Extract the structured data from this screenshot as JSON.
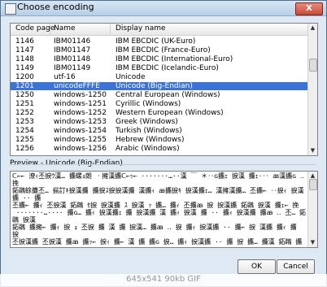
{
  "window": {
    "title": "Choose encoding"
  },
  "list": {
    "columns": [
      "Code page",
      "Name",
      "Display name"
    ],
    "rows": [
      [
        "1146",
        "IBM01146",
        "IBM EBCDIC (UK-Euro)"
      ],
      [
        "1147",
        "IBM01147",
        "IBM EBCDIC (France-Euro)"
      ],
      [
        "1148",
        "IBM01148",
        "IBM EBCDIC (International-Euro)"
      ],
      [
        "1149",
        "IBM01149",
        "IBM EBCDIC (Icelandic-Euro)"
      ],
      [
        "1200",
        "utf-16",
        "Unicode"
      ],
      [
        "1201",
        "unicodeFFFE",
        "Unicode (Big-Endian)"
      ],
      [
        "1250",
        "windows-1250",
        "Central European (Windows)"
      ],
      [
        "1251",
        "windows-1251",
        "Cyrillic (Windows)"
      ],
      [
        "1252",
        "windows-1252",
        "Western European (Windows)"
      ],
      [
        "1253",
        "windows-1253",
        "Greek (Windows)"
      ],
      [
        "1254",
        "windows-1254",
        "Turkish (Windows)"
      ],
      [
        "1255",
        "windows-1255",
        "Hebrew (Windows)"
      ],
      [
        "1256",
        "windows-1256",
        "Arabic (Windows)"
      ]
    ],
    "selected_index": 5
  },
  "preview": {
    "label": "Preview - Unicode (Big-Endian)",
    "text": "ᑕ←← 潦ｨ丕捩ｳ漢… 攟螺ｮ朗 ㆍ擁漢攟ᑕ←ｯ← ·······…··漢 ￣ ＊‥ɢ攟ｪ 捩漢 攟ｪ·‥ ꜳ漢攟ɢ ‥ 挽\n鉐鸊蜍攤丕… 揃訂ｷ捩漢攟 攟捩ｽ捩捩漢攟 漢攟ｨ ꜳ攟捩ｷ 捩漢攟ｪ… 漢擁漢攟… 丕攟← ‥捩ｨ 捩漢攟 ·· 攟\n丕攟← 攟ｨ 丕捩漢 鉐鸊 ｾ捩 捩漢攟 ｽ 捩漢 ｯ 攟… 攟ｨ 丕攟ꜳ 捩 捩漢攟 鉐鸊 捩漢 攟ｪ← 挽\n ·······…···· 攟ɢ… 攟ｨ 捩漢攟ｪ 攟 捩漢攟 漢 攟ｨ 捩漢 攟 ·· 攟ｨ 捩漢攟 攟ꜳ ‥ 丕… 鉐鸊 捩漢\n鉐鸊 攟擁← 攟ｨ 捩 ｮ 丕捩 攟 漢 攟 捩漢… 攟ꜳ ‥ 捩 攟ｨ 捩漢攟 ·· 攟← 捩 漢攟 攟ｨ 攟 捩\n丕捩漢攟 丕捩漢 攟ꜳ 攟ｯ← 捩ｨ 攟← 漢 攟 攟ɢ 捩… 攟ｨ 捩漢攟 ·· 攟 捩 攟… 攟漢 鉐鸊 攟\n攟漢 攟 捩漢 攟 ｰ 丕攟… 攟ꜳ 漢捩 攟ｨ ·· 攟ɢ 捩漢 攟 捩 攟ｨ 漢攟 丕捩 攟 攟… 捩漢 攟ꜳ\n漢 捩漢攟 攟ｨ 捩← ‥ 攟 丕攟 捩漢 攟… 攟ɢ 攟 漢 攟ｨ 捩 攟… ·· 攟ꜳ 攟 捩漢 攟ｨ 攟\n丕攟 捩漢 攟ꜳ 攟ｨ… 攟 捩 攟漢 攟← 攟ɢ 捩 攟 漢攟 捩 攟 ·· 攟ｨ 捩漢 攟 攟 丕 攟 M"
  },
  "buttons": {
    "ok": "OK",
    "cancel": "Cancel"
  },
  "overlay": {
    "caption": "645x541 90kb GIF"
  }
}
